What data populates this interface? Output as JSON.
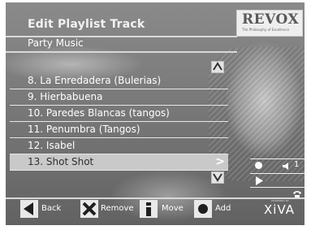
{
  "header": {
    "title": "Edit Playlist Track",
    "playlist_name": "Party Music",
    "logo": {
      "brand": "REVOX",
      "tagline": "The Philosophy of Excellence"
    }
  },
  "tracks": [
    {
      "label": "8. La Enredadera (Bulerias)",
      "selected": false
    },
    {
      "label": "9. Hierbabuena",
      "selected": false
    },
    {
      "label": "10. Paredes Blancas (tangos)",
      "selected": false
    },
    {
      "label": "11. Penumbra (Tangos)",
      "selected": false
    },
    {
      "label": "12. Isabel",
      "selected": false
    },
    {
      "label": "13. Shot Shot",
      "selected": true,
      "arrow": ">"
    }
  ],
  "scroll": {
    "up": "^",
    "down": "v"
  },
  "side_panel": {
    "rows": [
      "record-icon",
      "speaker-icon",
      "play-icon",
      "phone-icon"
    ],
    "channel_label": "1"
  },
  "softkeys": [
    {
      "icon": "left-arrow-icon",
      "label": "Back"
    },
    {
      "icon": "remove-x-icon",
      "label": "Remove"
    },
    {
      "icon": "info-i-icon",
      "label": "Move"
    },
    {
      "icon": "circle-icon",
      "label": "Add"
    }
  ],
  "brand_footer": {
    "small": "POWERED BY",
    "name": "XiVA"
  },
  "colors": {
    "background": "#7b7b7b",
    "selected_row": "#c9c9c9",
    "rule": "#d9d9d9"
  }
}
